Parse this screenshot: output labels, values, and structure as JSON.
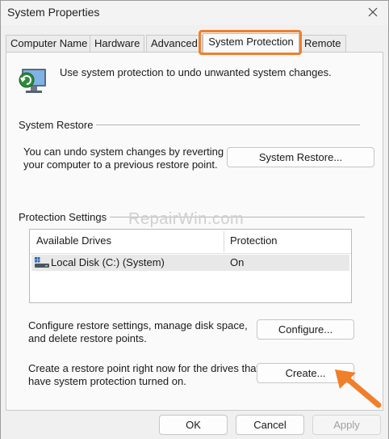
{
  "window": {
    "title": "System Properties"
  },
  "tabs": [
    {
      "label": "Computer Name"
    },
    {
      "label": "Hardware"
    },
    {
      "label": "Advanced"
    },
    {
      "label": "System Protection",
      "active": true
    },
    {
      "label": "Remote"
    }
  ],
  "intro": {
    "text": "Use system protection to undo unwanted system changes."
  },
  "system_restore": {
    "heading": "System Restore",
    "line1": "You can undo system changes by reverting",
    "line2": "your computer to a previous restore point.",
    "button": "System Restore..."
  },
  "protection_settings": {
    "heading": "Protection Settings",
    "columns": [
      "Available Drives",
      "Protection"
    ],
    "drives": [
      {
        "name": "Local Disk (C:) (System)",
        "protection": "On"
      }
    ],
    "configure_line1": "Configure restore settings, manage disk space,",
    "configure_line2": "and delete restore points.",
    "configure_button": "Configure...",
    "create_line1": "Create a restore point right now for the drives that",
    "create_line2": "have system protection turned on.",
    "create_button": "Create..."
  },
  "footer": {
    "ok": "OK",
    "cancel": "Cancel",
    "apply": "Apply"
  },
  "watermark": "RepairWin.com",
  "colors": {
    "highlight": "#f07f2a",
    "arrow": "#f07f2a",
    "window_bg": "#f0f0f0"
  },
  "icons": [
    "close-icon",
    "system-protection-icon",
    "drive-icon",
    "arrow-annotation"
  ]
}
